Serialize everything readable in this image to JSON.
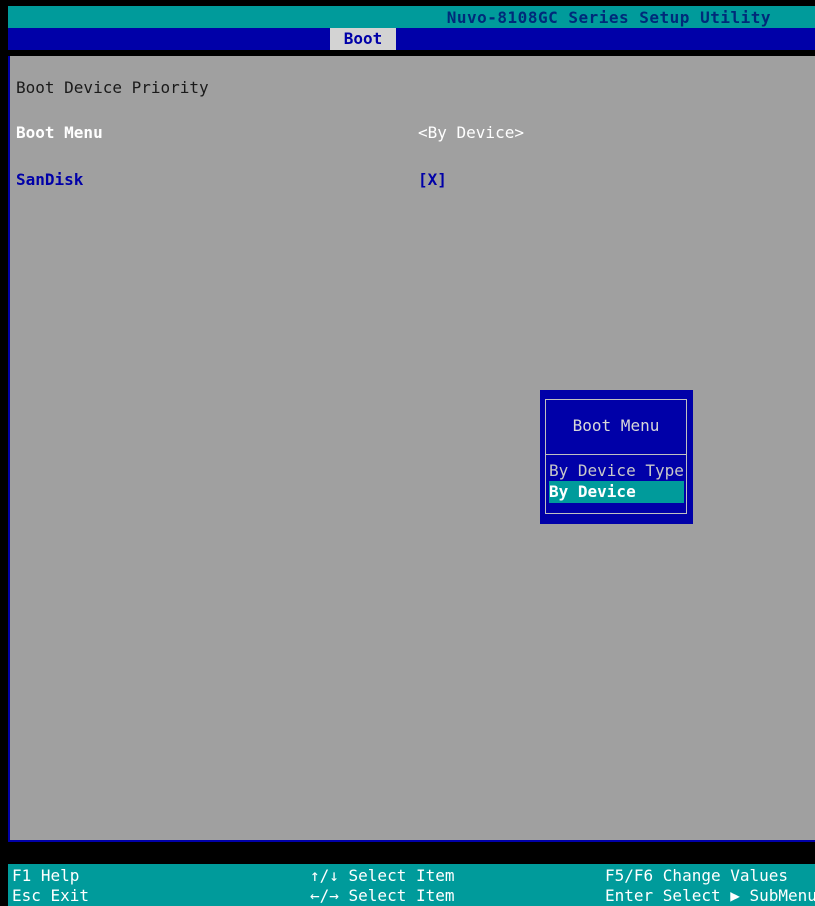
{
  "app": {
    "title": "Nuvo-8108GC Series Setup Utility"
  },
  "tabs": [
    {
      "label": "Boot",
      "active": true
    }
  ],
  "main": {
    "section_heading": "Boot Device Priority",
    "settings": [
      {
        "label": "Boot Menu",
        "value": "<By Device>"
      },
      {
        "label": "SanDisk",
        "value": "[X]"
      }
    ]
  },
  "popup": {
    "title": "Boot Menu",
    "options": [
      {
        "label": "By Device Type",
        "selected": false
      },
      {
        "label": "By Device",
        "selected": true
      }
    ]
  },
  "footer": {
    "help": "F1  Help",
    "exit": "Esc Exit",
    "select_item_updown": "↑/↓ Select Item",
    "select_item_leftright": "←/→ Select Item",
    "change_values": "F5/F6 Change Values",
    "enter_submenu": "Enter Select ▶ SubMenu"
  },
  "colors": {
    "background": "#a0a0a0",
    "titlebar": "#009b9b",
    "tabbar": "#0000a8",
    "highlight": "#009b9b",
    "selected_text": "#0000a8"
  }
}
